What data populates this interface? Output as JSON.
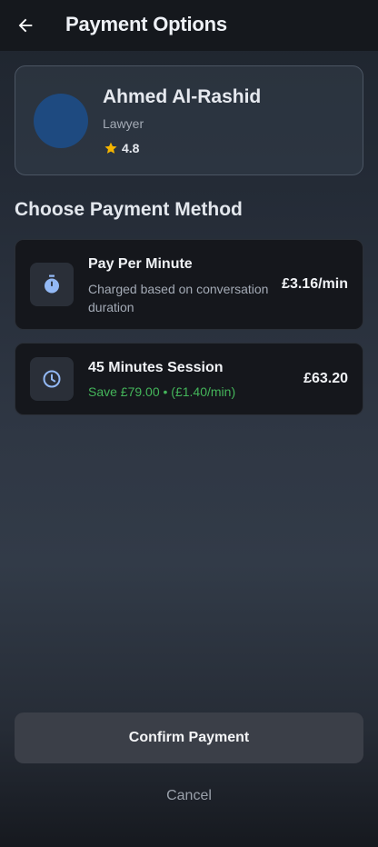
{
  "appbar": {
    "title": "Payment Options",
    "back_icon": "arrow-left-icon"
  },
  "profile": {
    "name": "Ahmed Al-Rashid",
    "role": "Lawyer",
    "rating": "4.8",
    "avatar_color": "#1e4a80",
    "star_color": "#f4b400"
  },
  "section_title": "Choose Payment Method",
  "options": [
    {
      "icon": "stopwatch-icon",
      "title": "Pay Per Minute",
      "description": "Charged based on conversation duration",
      "price": "£3.16/min"
    },
    {
      "icon": "clock-icon",
      "title": "45 Minutes Session",
      "savings": "Save £79.00 • (£1.40/min)",
      "price": "£63.20"
    }
  ],
  "actions": {
    "confirm": "Confirm Payment",
    "cancel": "Cancel"
  },
  "colors": {
    "accent_icon": "#93b9f5",
    "savings_green": "#44b55a"
  }
}
